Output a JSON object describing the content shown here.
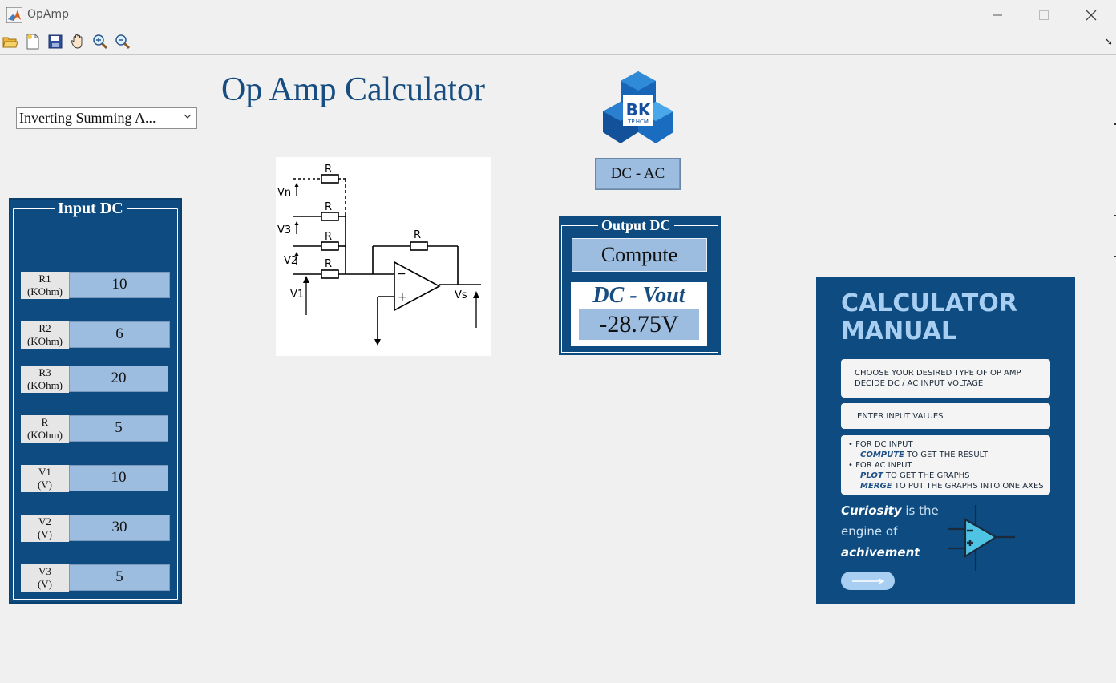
{
  "window": {
    "title": "OpAmp",
    "controls": {
      "minimize": "minimize-icon",
      "maximize": "maximize-icon",
      "close": "close-icon"
    }
  },
  "toolbar": {
    "items": [
      "open-folder-icon",
      "new-file-icon",
      "save-icon",
      "pan-hand-icon",
      "zoom-in-icon",
      "zoom-out-icon"
    ],
    "undock_icon": "undock-arrow-icon",
    "undock_glyph": "➘"
  },
  "header": {
    "title": "Op Amp Calculator"
  },
  "type_select": {
    "value": "Inverting Summing A...",
    "chevron": "⌵"
  },
  "input_panel": {
    "legend": "Input DC",
    "rows": [
      {
        "label_top": "R1",
        "label_bottom": "(KOhm)",
        "value": "10"
      },
      {
        "label_top": "R2",
        "label_bottom": "(KOhm)",
        "value": "6"
      },
      {
        "label_top": "R3",
        "label_bottom": "(KOhm)",
        "value": "20"
      },
      {
        "label_top": "R",
        "label_bottom": "(KOhm)",
        "value": "5"
      },
      {
        "label_top": "V1",
        "label_bottom": "(V)",
        "value": "10"
      },
      {
        "label_top": "V2",
        "label_bottom": "(V)",
        "value": "30"
      },
      {
        "label_top": "V3",
        "label_bottom": "(V)",
        "value": "5"
      }
    ]
  },
  "circuit": {
    "labels": {
      "r": "R",
      "vn": "Vn",
      "v3": "V3",
      "v2": "V2",
      "v1": "V1",
      "vs": "Vs",
      "minus": "−",
      "plus": "+"
    }
  },
  "logo": {
    "text": "BK",
    "subtext": "TP.HCM"
  },
  "mode_button": {
    "label": "DC - AC"
  },
  "output_panel": {
    "legend": "Output DC",
    "compute_label": "Compute",
    "result_title": "DC - Vout",
    "result_value": "-28.75V"
  },
  "manual": {
    "title_line1": "CALCULATOR",
    "title_line2": "MANUAL",
    "card1": [
      "CHOOSE YOUR DESIRED TYPE OF OP AMP",
      "DECIDE DC / AC INPUT VOLTAGE"
    ],
    "card2": "ENTER INPUT VALUES",
    "card3": {
      "bullet1": "FOR DC INPUT",
      "bullet1_em": "COMPUTE",
      "bullet1_rest": " TO GET THE RESULT",
      "bullet2": "FOR AC INPUT",
      "bullet2a_em": "PLOT",
      "bullet2a_rest": " TO GET THE GRAPHS",
      "bullet2b_em": "MERGE",
      "bullet2b_rest": " TO PUT THE GRAPHS INTO ONE AXES"
    },
    "quote": {
      "w1": "Curiosity",
      "w2": " is the",
      "w3": "engine of",
      "w4": "achivement"
    }
  },
  "colors": {
    "panel_blue": "#0d4b80",
    "field_blue": "#9dbde0",
    "title_blue": "#174d80",
    "manual_accent": "#a8cff1"
  }
}
